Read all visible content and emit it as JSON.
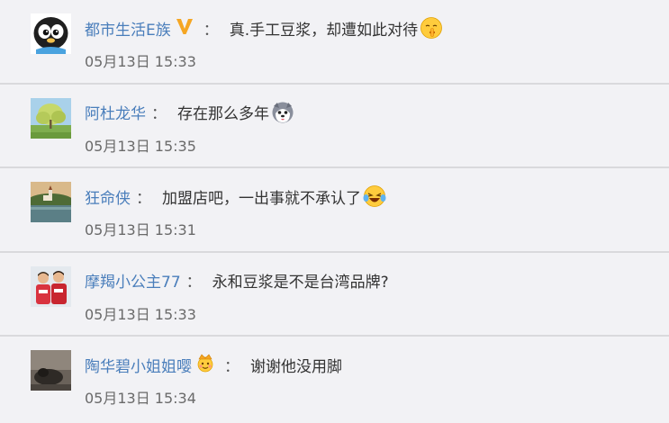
{
  "comments": [
    {
      "username": "都市生活E族",
      "separator": "：",
      "text": "真.手工豆浆，却遭如此对待",
      "time": "05月13日 15:33",
      "badge": "verified-v-badge",
      "emoji": "shushing-face-emoji",
      "avatar": "penguin-avatar"
    },
    {
      "username": "阿杜龙华",
      "separator": "：",
      "text": "存在那么多年",
      "time": "05月13日 15:35",
      "emoji": "husky-dog-emoji",
      "avatar": "tree-landscape-avatar"
    },
    {
      "username": "狂命侠",
      "separator": "：",
      "text": "加盟店吧，一出事就不承认了",
      "time": "05月13日 15:31",
      "emoji": "laughing-tears-emoji",
      "avatar": "lake-church-avatar"
    },
    {
      "username": "摩羯小公主77",
      "separator": "：",
      "text": "永和豆浆是不是台湾品牌?",
      "time": "05月13日 15:33",
      "avatar": "athletes-avatar"
    },
    {
      "username": "陶华碧小姐姐嘤",
      "separator": "：",
      "text": "谢谢他没用脚",
      "time": "05月13日 15:34",
      "badge": "crown-badge",
      "avatar": "dark-photo-avatar"
    }
  ],
  "colors": {
    "background": "#f2f2f5",
    "username": "#4a7ebb",
    "text": "#333333",
    "time": "#6a6a6a",
    "divider": "#d9d9dc"
  }
}
